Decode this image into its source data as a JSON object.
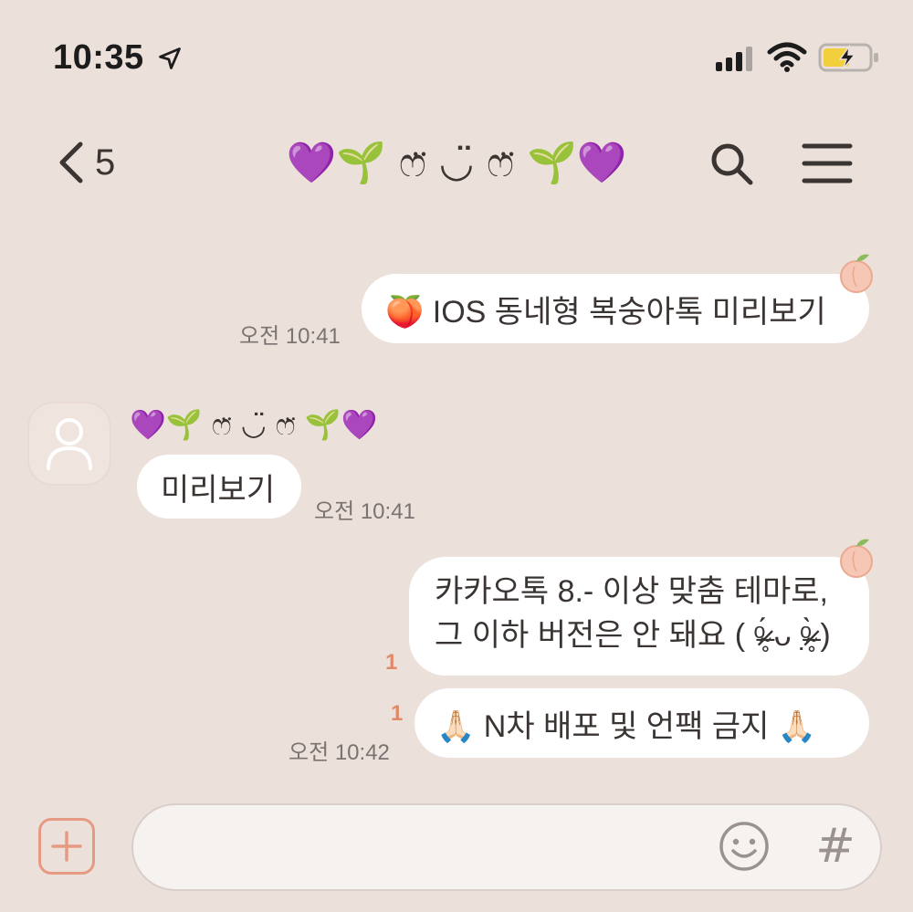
{
  "status_bar": {
    "time": "10:35",
    "location_icon": "location-arrow-icon",
    "signal_icon": "cellular-signal-icon",
    "wifi_icon": "wifi-icon",
    "battery_icon": "battery-charging-icon"
  },
  "header": {
    "back_count": "5",
    "title": "💜🌱 ෆ̈ ◡̈ ෆ̈ 🌱💜",
    "search_icon": "search-icon",
    "menu_icon": "hamburger-menu-icon"
  },
  "messages": [
    {
      "direction": "outgoing",
      "text": "🍑 IOS 동네형 복숭아톡 미리보기",
      "time": "오전 10:41"
    },
    {
      "direction": "incoming",
      "sender": "💜🌱 ෆ̈ ◡̈ ෆ̈ 🌱💜",
      "text": "미리보기",
      "time": "오전 10:41"
    },
    {
      "direction": "outgoing",
      "lines": [
        "카카오톡 8.- 이상 맞춤 테마로,",
        "그 이하 버전은 안 돼요 ( ᵒ̴̶̷̥́ ᴗ ᵒ̴̶̷̣̥̀ )"
      ],
      "unread": "1"
    },
    {
      "direction": "outgoing",
      "text": "🙏🏻 N차 배포 및 언팩 금지 🙏🏻",
      "unread": "1",
      "time": "오전 10:42"
    }
  ],
  "input": {
    "value": "",
    "plus_icon": "plus-icon",
    "emoji_icon": "emoji-smile-icon",
    "hash_label": "#"
  },
  "colors": {
    "background": "#ece0da",
    "bubble": "#ffffff",
    "accent": "#e69a83",
    "unread": "#e08a6a"
  }
}
